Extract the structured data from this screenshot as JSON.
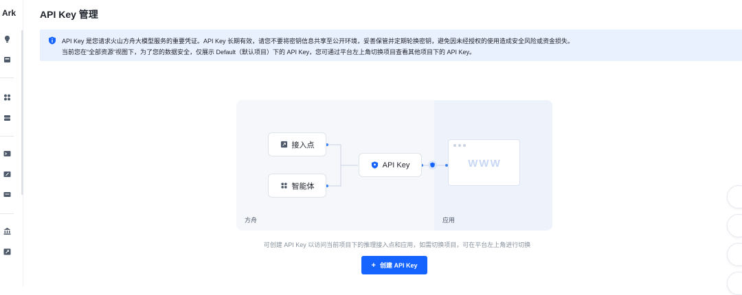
{
  "sidebar": {
    "brand": "Ark",
    "icons": [
      "idea-icon",
      "inbox-icon",
      "apps-icon",
      "storage-icon",
      "terminal-icon",
      "edit-icon",
      "chat-icon",
      "bank-icon",
      "rocket-icon"
    ]
  },
  "page": {
    "title": "API Key 管理"
  },
  "notice": {
    "line1": "API Key 是您请求火山方舟大模型服务的重要凭证。API Key 长期有效，请您不要将密钥信息共享至公开环境，妥善保管并定期轮换密钥，避免因未经授权的使用造成安全风险或资金损失。",
    "line2": "当前您在“全部资源”视图下，为了您的数据安全，仅展示 Default（默认项目）下的 API Key，您可通过平台左上角切换项目查看其他项目下的 API Key。"
  },
  "diagram": {
    "node_endpoint": "接入点",
    "node_agent": "智能体",
    "node_apikey": "API Key",
    "window_text": "WWW",
    "left_label": "方舟",
    "right_label": "应用"
  },
  "hint": "可创建 API Key 以访问当前项目下的推理接入点和应用，如需切换项目，可在平台左上角进行切换",
  "create_button": {
    "plus": "+",
    "label": "创建 API Key"
  },
  "colors": {
    "primary": "#1664ff",
    "notice_bg": "#e9f0fe"
  }
}
